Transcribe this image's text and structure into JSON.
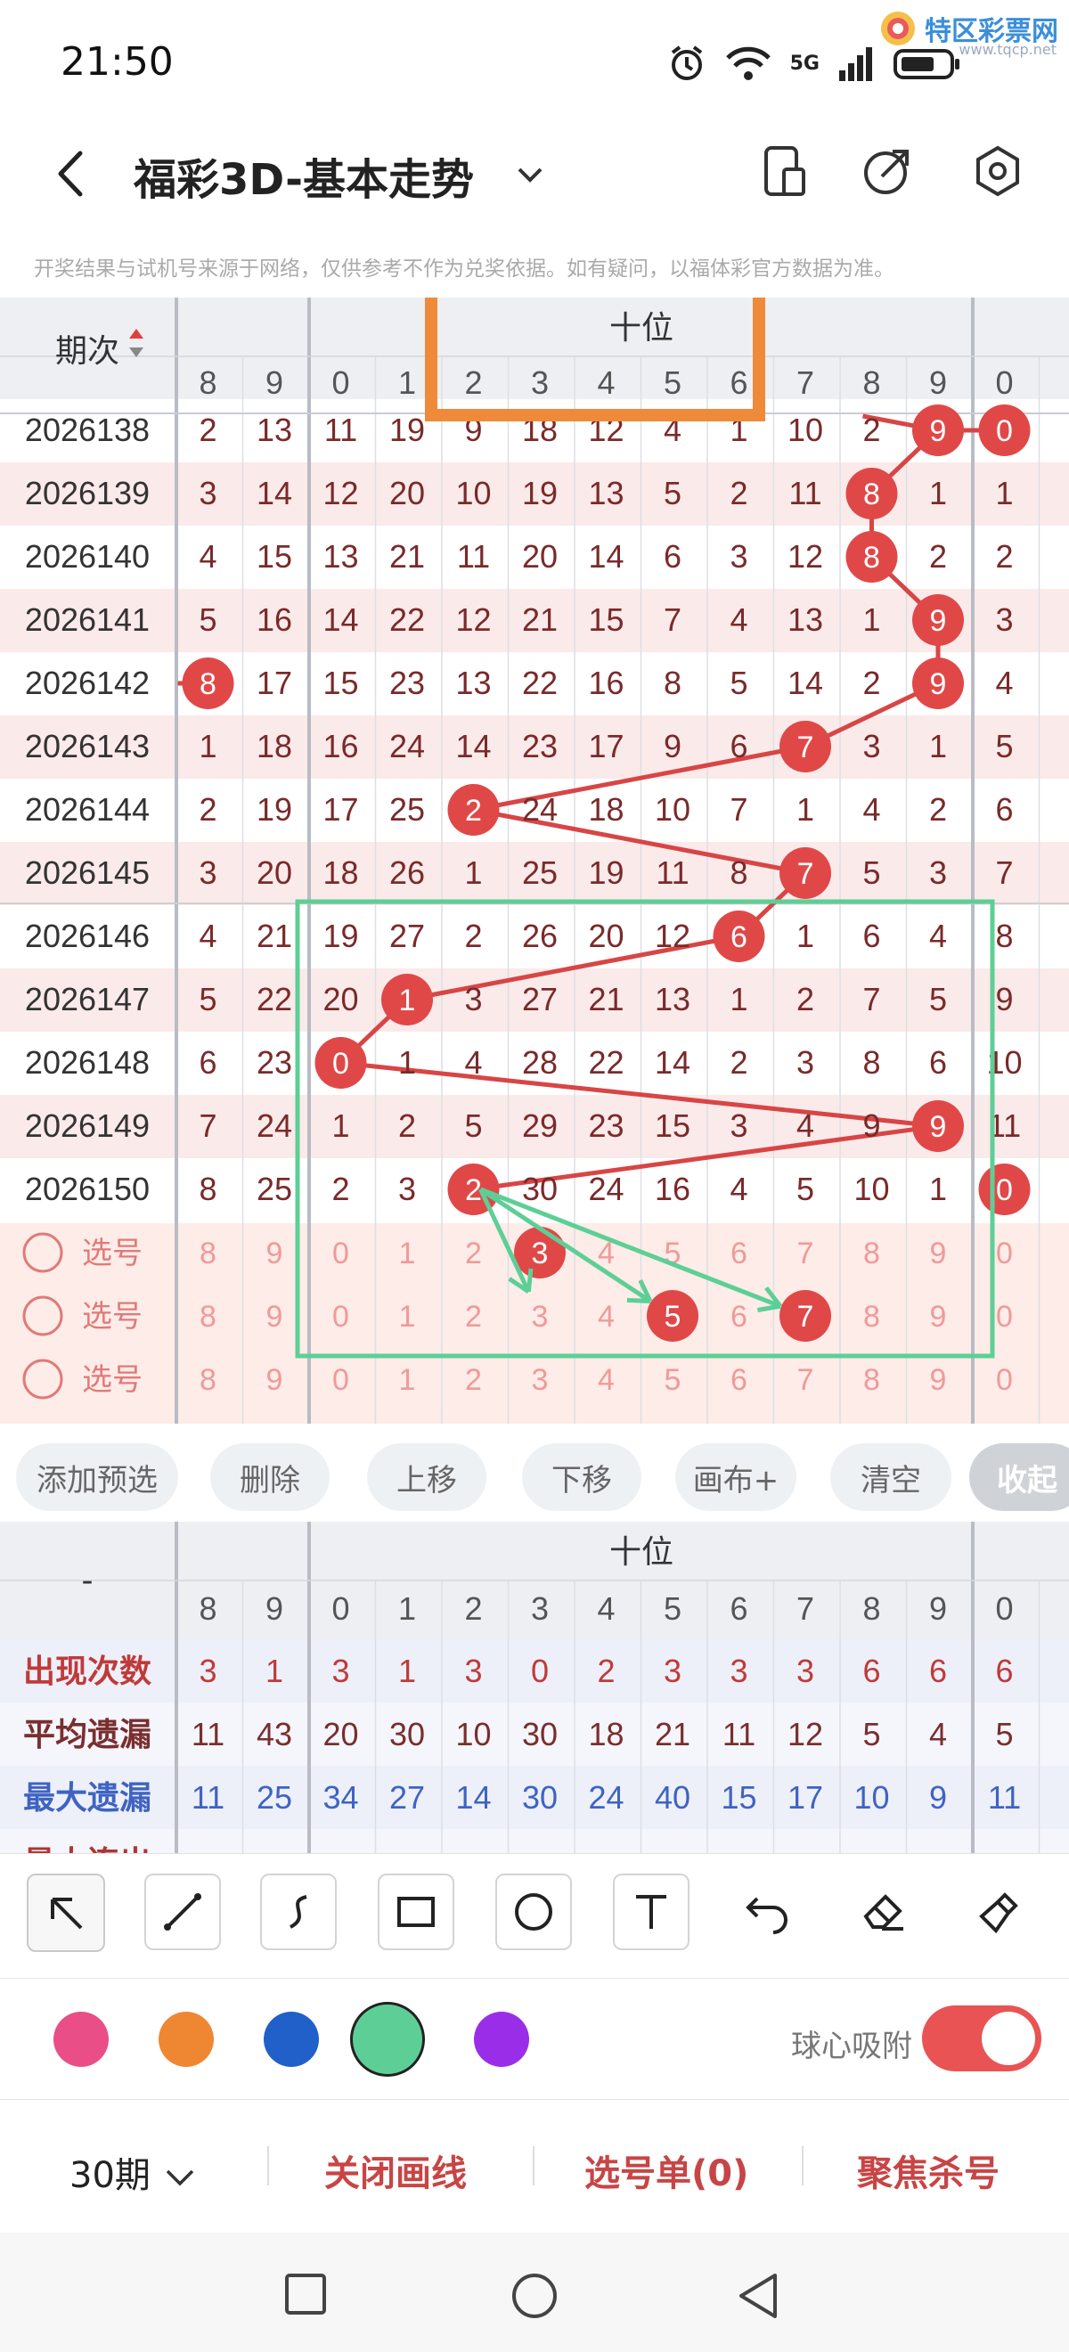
{
  "status_bar": {
    "time": "21:50",
    "network": "5G",
    "watermark": "特区彩票网",
    "watermark_sub": "www.tqcp.net",
    "icons": [
      "alarm-icon",
      "wifi-icon",
      "signal-icon",
      "battery-icon"
    ]
  },
  "header": {
    "title": "福彩3D-基本走势",
    "notice": "开奖结果与试机号来源于网络，仅供参考不作为兑奖依据。如有疑问，以福体彩官方数据为准。"
  },
  "table": {
    "period_header": "期次",
    "group_header": "十位",
    "col_heads": [
      "8",
      "9",
      "0",
      "1",
      "2",
      "3",
      "4",
      "5",
      "6",
      "7",
      "8",
      "9",
      "0"
    ],
    "rows": [
      {
        "period": "2026138",
        "cells": [
          "2",
          "13",
          "11",
          "19",
          "9",
          "18",
          "12",
          "4",
          "1",
          "10",
          "2",
          "9",
          "0"
        ],
        "hit": 11
      },
      {
        "period": "2026139",
        "cells": [
          "3",
          "14",
          "12",
          "20",
          "10",
          "19",
          "13",
          "5",
          "2",
          "11",
          "8",
          "1",
          "1"
        ],
        "hit": 10
      },
      {
        "period": "2026140",
        "cells": [
          "4",
          "15",
          "13",
          "21",
          "11",
          "20",
          "14",
          "6",
          "3",
          "12",
          "8",
          "2",
          "2"
        ],
        "hit": 10
      },
      {
        "period": "2026141",
        "cells": [
          "5",
          "16",
          "14",
          "22",
          "12",
          "21",
          "15",
          "7",
          "4",
          "13",
          "1",
          "9",
          "3"
        ],
        "hit": 11
      },
      {
        "period": "2026142",
        "cells": [
          "8",
          "17",
          "15",
          "23",
          "13",
          "22",
          "16",
          "8",
          "5",
          "14",
          "2",
          "9",
          "4"
        ],
        "hit": 11
      },
      {
        "period": "2026143",
        "cells": [
          "1",
          "18",
          "16",
          "24",
          "14",
          "23",
          "17",
          "9",
          "6",
          "7",
          "3",
          "1",
          "5"
        ],
        "hit": 9
      },
      {
        "period": "2026144",
        "cells": [
          "2",
          "19",
          "17",
          "25",
          "2",
          "24",
          "18",
          "10",
          "7",
          "1",
          "4",
          "2",
          "6"
        ],
        "hit": 4
      },
      {
        "period": "2026145",
        "cells": [
          "3",
          "20",
          "18",
          "26",
          "1",
          "25",
          "19",
          "11",
          "8",
          "7",
          "5",
          "3",
          "7"
        ],
        "hit": 9
      },
      {
        "period": "2026146",
        "cells": [
          "4",
          "21",
          "19",
          "27",
          "2",
          "26",
          "20",
          "12",
          "6",
          "1",
          "6",
          "4",
          "8"
        ],
        "hit": 8
      },
      {
        "period": "2026147",
        "cells": [
          "5",
          "22",
          "20",
          "1",
          "3",
          "27",
          "21",
          "13",
          "1",
          "2",
          "7",
          "5",
          "9"
        ],
        "hit": 3
      },
      {
        "period": "2026148",
        "cells": [
          "6",
          "23",
          "0",
          "1",
          "4",
          "28",
          "22",
          "14",
          "2",
          "3",
          "8",
          "6",
          "10"
        ],
        "hit": 2
      },
      {
        "period": "2026149",
        "cells": [
          "7",
          "24",
          "1",
          "2",
          "5",
          "29",
          "23",
          "15",
          "3",
          "4",
          "9",
          "9",
          "11"
        ],
        "hit": 11
      },
      {
        "period": "2026150",
        "cells": [
          "8",
          "25",
          "2",
          "3",
          "2",
          "30",
          "24",
          "16",
          "4",
          "5",
          "10",
          "1",
          "0"
        ],
        "hit": 4
      }
    ],
    "extra_hits": [
      {
        "row": 0,
        "col": 12
      },
      {
        "row": 4,
        "col": 0
      },
      {
        "row": 12,
        "col": 12
      }
    ],
    "pick_label": "选号",
    "pick_rows": [
      {
        "values": [
          "8",
          "9",
          "0",
          "1",
          "2",
          "3",
          "4",
          "5",
          "6",
          "7",
          "8",
          "9",
          "0"
        ],
        "selected": [
          5
        ]
      },
      {
        "values": [
          "8",
          "9",
          "0",
          "1",
          "2",
          "3",
          "4",
          "5",
          "6",
          "7",
          "8",
          "9",
          "0"
        ],
        "selected": [
          7,
          9
        ]
      },
      {
        "values": [
          "8",
          "9",
          "0",
          "1",
          "2",
          "3",
          "4",
          "5",
          "6",
          "7",
          "8",
          "9",
          "0"
        ],
        "selected": []
      }
    ]
  },
  "toolbar": {
    "add": "添加预选",
    "delete": "删除",
    "up": "上移",
    "down": "下移",
    "canvas": "画布+",
    "clear": "清空",
    "collapse": "收起"
  },
  "stats": {
    "corner": "-",
    "group_header": "十位",
    "col_heads": [
      "8",
      "9",
      "0",
      "1",
      "2",
      "3",
      "4",
      "5",
      "6",
      "7",
      "8",
      "9",
      "0"
    ],
    "rows": [
      {
        "label": "出现次数",
        "values": [
          "3",
          "1",
          "3",
          "1",
          "3",
          "0",
          "2",
          "3",
          "3",
          "3",
          "6",
          "6",
          "6"
        ],
        "color": "#c03a3a"
      },
      {
        "label": "平均遗漏",
        "values": [
          "11",
          "43",
          "20",
          "30",
          "10",
          "30",
          "18",
          "21",
          "11",
          "12",
          "5",
          "4",
          "5"
        ],
        "color": "#7a2e2e"
      },
      {
        "label": "最大遗漏",
        "values": [
          "11",
          "25",
          "34",
          "27",
          "14",
          "30",
          "24",
          "40",
          "15",
          "17",
          "10",
          "9",
          "11"
        ],
        "color": "#3f63c2"
      }
    ],
    "partial_row_label": "最大连出"
  },
  "draw_tools": [
    "pointer-icon",
    "line-icon",
    "curve-icon",
    "rectangle-icon",
    "circle-icon",
    "text-icon",
    "undo-icon",
    "eraser-icon",
    "brush-clear-icon"
  ],
  "palette": {
    "colors": [
      "#e94f86",
      "#ef8732",
      "#2160c8",
      "#5dcf96",
      "#9a2ee8"
    ],
    "selected": "#5dcf96",
    "magnet_label": "球心吸附",
    "magnet_on": true
  },
  "bottom": {
    "period": "30期",
    "close_lines": "关闭画线",
    "pick_list": "选号单(0)",
    "focus_kill": "聚焦杀号"
  }
}
